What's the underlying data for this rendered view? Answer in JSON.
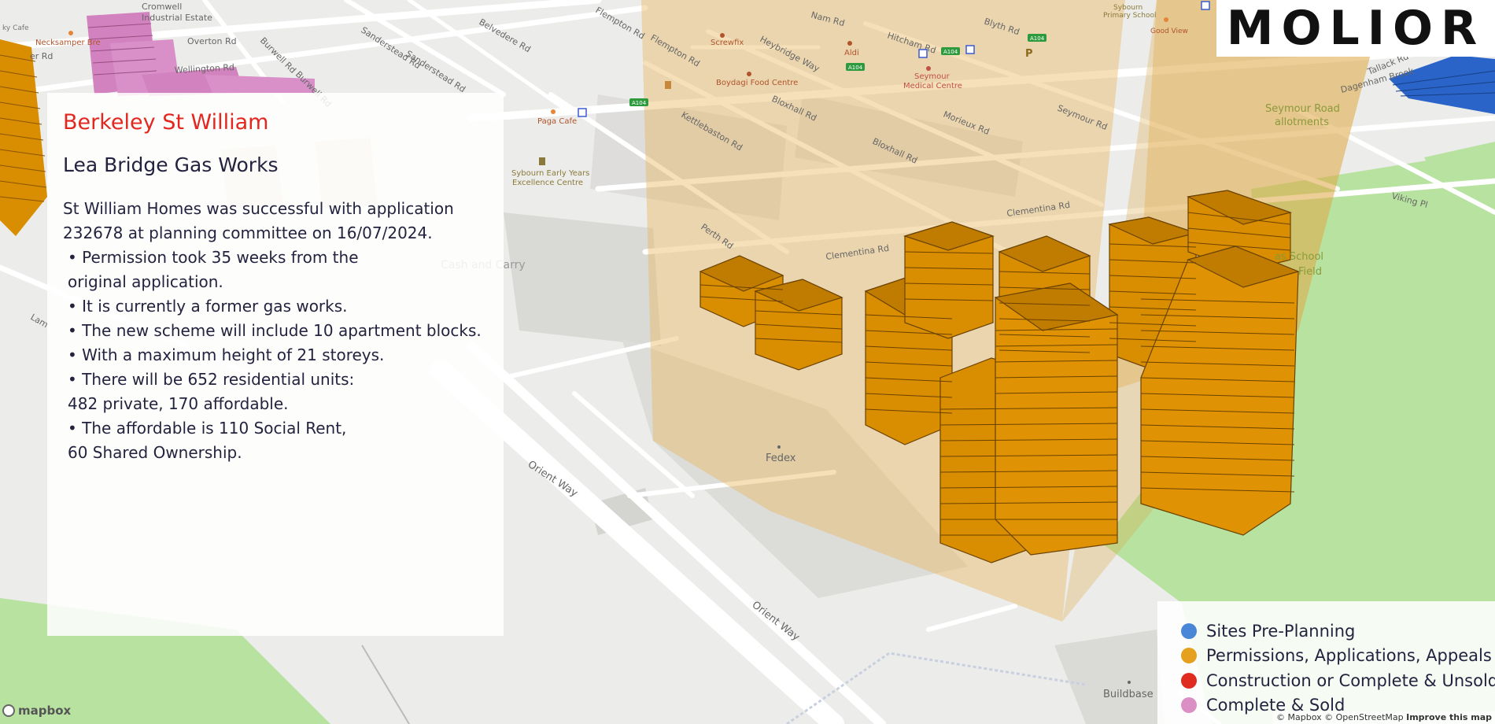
{
  "brand": {
    "name": "MOLIOR"
  },
  "panel": {
    "developer": "Berkeley St William",
    "site": "Lea Bridge Gas Works",
    "summary": "St William Homes was successful with application\n232678 at planning committee on 16/07/2024.",
    "bullets": [
      "• Permission took 35 weeks from the\n   original application.",
      "• It is currently a former gas works.",
      "• The new scheme will include 10 apartment blocks.",
      "• With a maximum height of 21 storeys.",
      "• There will be 652 residential units:\n   482 private, 170 affordable.",
      "• The affordable is 110 Social Rent,\n   60 Shared Ownership."
    ]
  },
  "legend": {
    "items": [
      {
        "label": "Sites Pre-Planning",
        "color": "#4a86d8"
      },
      {
        "label": "Permissions, Applications, Appeals",
        "color": "#e5a11e"
      },
      {
        "label": "Construction or Complete & Unsold",
        "color": "#e02b20"
      },
      {
        "label": "Complete & Sold",
        "color": "#dc8fc4"
      }
    ]
  },
  "map": {
    "streets": {
      "cromwell": "Cromwell",
      "industrial_estate": "Industrial Estate",
      "overton_rd": "Overton Rd",
      "wellington_rd": "Wellington Rd",
      "burwell_rd": "Burwell Rd",
      "burwell_rd_2": "Burwell Rd",
      "belvedere_rd": "Belvedere Rd",
      "sanderstead_rd": "Sanderstead Rd",
      "sanderstead_rd_2": "Sanderstead Rd",
      "flempton_rd": "Flempton Rd",
      "flempton_rd_2": "Flempton Rd",
      "heybridge_way": "Heybridge Way",
      "hitcham_rd": "Hitcham Rd",
      "blyth_rd": "Blyth Rd",
      "bloxhall_rd": "Bloxhall Rd",
      "bloxhall_rd_2": "Bloxhall Rd",
      "kettlebaston_rd": "Kettlebaston Rd",
      "morieux_rd": "Morieux Rd",
      "seymour_rd": "Seymour Rd",
      "clementina_rd": "Clementina Rd",
      "clementina_rd_2": "Clementina Rd",
      "perth_rd": "Perth Rd",
      "orient_way": "Orient Way",
      "orient_way_2": "Orient Way",
      "tallack_rd": "Tallack Rd",
      "dagenham_brook": "Dagenham Brook",
      "viking_pl": "Viking Pl",
      "nam_rd": "Nam Rd",
      "er_rd": "er Rd",
      "lam": "Lam"
    },
    "pois": {
      "necksamper": "Necksamper Bre",
      "paga_cafe": "Paga Cafe",
      "screwfix": "Screwfix",
      "aldi": "Aldi",
      "boydagi": "Boydagi Food Centre",
      "seymour_medical_1": "Seymour",
      "seymour_medical_2": "Medical Centre",
      "sybourn_school_1": "Sybourn",
      "sybourn_school_2": "Primary School",
      "good_view": "Good View",
      "sybourn_early_1": "Sybourn Early Years",
      "sybourn_early_2": "Excellence Centre",
      "cash_carry": "Cash and Carry",
      "fedex": "Fedex",
      "buildbase": "Buildbase",
      "allotments_1": "Seymour Road",
      "allotments_2": "allotments",
      "school_field_1": "as School",
      "school_field_2": "Field",
      "sky_cafe": "ky Cafe"
    },
    "road_shields": [
      "A104",
      "A104",
      "A104",
      "A104"
    ]
  },
  "attribution": {
    "mapbox_logo": "mapbox",
    "text": "© Mapbox © OpenStreetMap",
    "improve": "Improve this map"
  }
}
